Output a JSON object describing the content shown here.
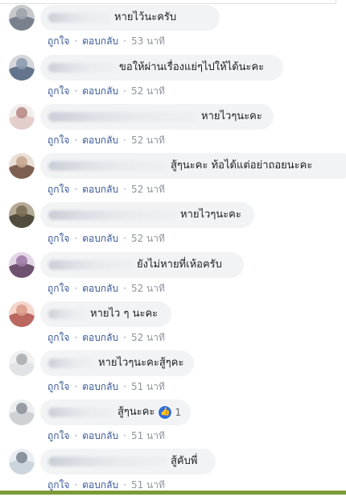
{
  "actions": {
    "like": "ถูกใจ",
    "reply": "ตอบกลับ",
    "separator": "·"
  },
  "comments": [
    {
      "text": "หายไว้นะครับ",
      "time": "53 นาที",
      "avatar_colors": [
        "#6b7383",
        "#9ea4ad",
        "#c7c9cc"
      ]
    },
    {
      "text": "ขอให้ผ่านเรื่องแย่ๆไปให้ได้นะคะ",
      "time": "52 นาที",
      "avatar_colors": [
        "#50637e",
        "#8c9bb0",
        "#d5d7db"
      ]
    },
    {
      "text": "หายไวๆนะคะ",
      "time": "52 นาที",
      "avatar_colors": [
        "#e0c8c4",
        "#b98b86",
        "#f3eeee"
      ]
    },
    {
      "text": "สู้ๆนะคะ ท้อได้แต่อย่าถอยนะคะ",
      "time": "52 นาที",
      "avatar_colors": [
        "#6b4a3a",
        "#c8a690",
        "#e9dfd7"
      ]
    },
    {
      "text": "หายไวๆนะคะ",
      "time": "52 นาที",
      "avatar_colors": [
        "#3f3b2e",
        "#7d6e55",
        "#b5ab97"
      ]
    },
    {
      "text": "ยังไม่หายที่เห้อครับ",
      "time": "52 นาที",
      "avatar_colors": [
        "#583a5a",
        "#a07ba6",
        "#e3d8e5"
      ]
    },
    {
      "text": "หายไว ๆ นะคะ",
      "time": "52 นาที",
      "avatar_colors": [
        "#b0544c",
        "#d99d8b",
        "#f4d6cd"
      ]
    },
    {
      "text": "หายไวๆนะคะสู้ๆคะ",
      "time": "51 นาที",
      "avatar_colors": [
        "#dfe1e4",
        "#aaaeb4",
        "#f1f1f2"
      ]
    },
    {
      "text": "สู้ๆนะคะ",
      "time": "51 นาที",
      "avatar_colors": [
        "#c9ccd0",
        "#8f949b",
        "#eceef0"
      ],
      "reaction": {
        "icon": "like-icon",
        "count": "1"
      }
    },
    {
      "text": "สู้คับพี่",
      "time": "51 นาที",
      "avatar_colors": [
        "#c8d0d8",
        "#7e8a96",
        "#eaeef2"
      ]
    }
  ]
}
